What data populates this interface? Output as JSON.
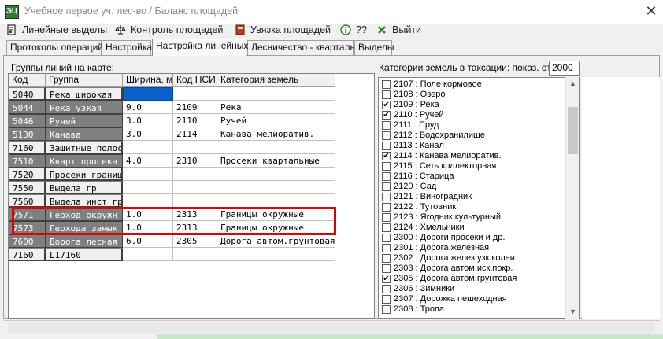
{
  "window": {
    "title": "Учебное первое уч. лес-во / Баланс площадей",
    "close_glyph": "✕",
    "app_icon_text": "ЭЦ"
  },
  "toolbar": {
    "items": [
      {
        "label": "Линейные выделы",
        "icon": "document-edit-icon"
      },
      {
        "label": "Контроль площадей",
        "icon": "scales-icon"
      },
      {
        "label": "Увязка площадей",
        "icon": "notebook-icon"
      },
      {
        "label": "??",
        "icon": "info-icon"
      },
      {
        "label": "Выйти",
        "icon": "exit-x-icon"
      }
    ]
  },
  "tabs": [
    {
      "label": "Протоколы операций",
      "active": false
    },
    {
      "label": "Настройка",
      "active": false
    },
    {
      "label": "Настройка линейных",
      "active": true
    },
    {
      "label": "Лесничество - кварталы",
      "active": false
    },
    {
      "label": "Выделы",
      "active": false
    }
  ],
  "left_panel": {
    "title": "Группы линий на карте:",
    "columns": [
      "Код",
      "Группа",
      "Ширина, м",
      "Код НСИ",
      "Категория земель"
    ],
    "rows": [
      {
        "code": "5040",
        "group": "Река широкая",
        "width": "",
        "nsi": "",
        "category": "",
        "style": "light",
        "width_selected": true
      },
      {
        "code": "5044",
        "group": "Река узкая",
        "width": "9.0",
        "nsi": "2109",
        "category": "Река",
        "style": "dark"
      },
      {
        "code": "5046",
        "group": "Ручей",
        "width": "3.0",
        "nsi": "2110",
        "category": "Ручей",
        "style": "dark"
      },
      {
        "code": "5130",
        "group": "Канава",
        "width": "3.0",
        "nsi": "2114",
        "category": "Канава мелиоратив.",
        "style": "dark"
      },
      {
        "code": "7160",
        "group": "Защитные полос",
        "width": "",
        "nsi": "",
        "category": "",
        "style": "light"
      },
      {
        "code": "7510",
        "group": "Кварт просека",
        "width": "4.0",
        "nsi": "2310",
        "category": "Просеки квартальные",
        "style": "dark"
      },
      {
        "code": "7520",
        "group": "Просеки границ",
        "width": "",
        "nsi": "",
        "category": "",
        "style": "light"
      },
      {
        "code": "7550",
        "group": "Выдела гр",
        "width": "",
        "nsi": "",
        "category": "",
        "style": "light"
      },
      {
        "code": "7560",
        "group": "Выдела инст гр",
        "width": "",
        "nsi": "",
        "category": "",
        "style": "light"
      },
      {
        "code": "7571",
        "group": "Геоход окружн",
        "width": "1.0",
        "nsi": "2313",
        "category": "Границы окружные",
        "style": "dark"
      },
      {
        "code": "7573",
        "group": "Геохода замык",
        "width": "1.0",
        "nsi": "2313",
        "category": "Границы окружные",
        "style": "dark"
      },
      {
        "code": "7600",
        "group": "Дорога лесная",
        "width": "6.0",
        "nsi": "2305",
        "category": "Дорога автом.грунтовая",
        "style": "dark"
      },
      {
        "code": "7160",
        "group": "L17160",
        "width": "",
        "nsi": "",
        "category": "",
        "style": "light"
      }
    ]
  },
  "right_panel": {
    "label": "Категории земель в таксации:  показ. от",
    "show_from_value": "2000",
    "categories": [
      {
        "text": "2107 : Поле кормовое",
        "checked": false
      },
      {
        "text": "2108 : Озеро",
        "checked": false
      },
      {
        "text": "2109 : Река",
        "checked": true
      },
      {
        "text": "2110 : Ручей",
        "checked": true
      },
      {
        "text": "2111 : Пруд",
        "checked": false
      },
      {
        "text": "2112 : Водохранилище",
        "checked": false
      },
      {
        "text": "2113 : Канал",
        "checked": false
      },
      {
        "text": "2114 : Канава мелиоратив.",
        "checked": true
      },
      {
        "text": "2115 : Сеть коллекторная",
        "checked": false
      },
      {
        "text": "2116 : Старица",
        "checked": false
      },
      {
        "text": "2120 : Сад",
        "checked": false
      },
      {
        "text": "2121 : Виноградник",
        "checked": false
      },
      {
        "text": "2122 : Тутовник",
        "checked": false
      },
      {
        "text": "2123 : Ягодник культурный",
        "checked": false
      },
      {
        "text": "2124 : Хмельники",
        "checked": false
      },
      {
        "text": "2300 : Дороги просеки и др.",
        "checked": false
      },
      {
        "text": "2301 : Дорога железная",
        "checked": false
      },
      {
        "text": "2302 : Дорога желез.узк.колеи",
        "checked": false
      },
      {
        "text": "2303 : Дорога автом.иск.покр.",
        "checked": false
      },
      {
        "text": "2305 : Дорога автом.грунтовая",
        "checked": true
      },
      {
        "text": "2306 : Зимники",
        "checked": false
      },
      {
        "text": "2307 : Дорожка пешеходная",
        "checked": false
      },
      {
        "text": "2308 : Тропа",
        "checked": false
      }
    ]
  },
  "colors": {
    "highlight": "#e00000",
    "selected_cell": "#0a5fc8",
    "dark_cell": "#7f7f7f"
  }
}
